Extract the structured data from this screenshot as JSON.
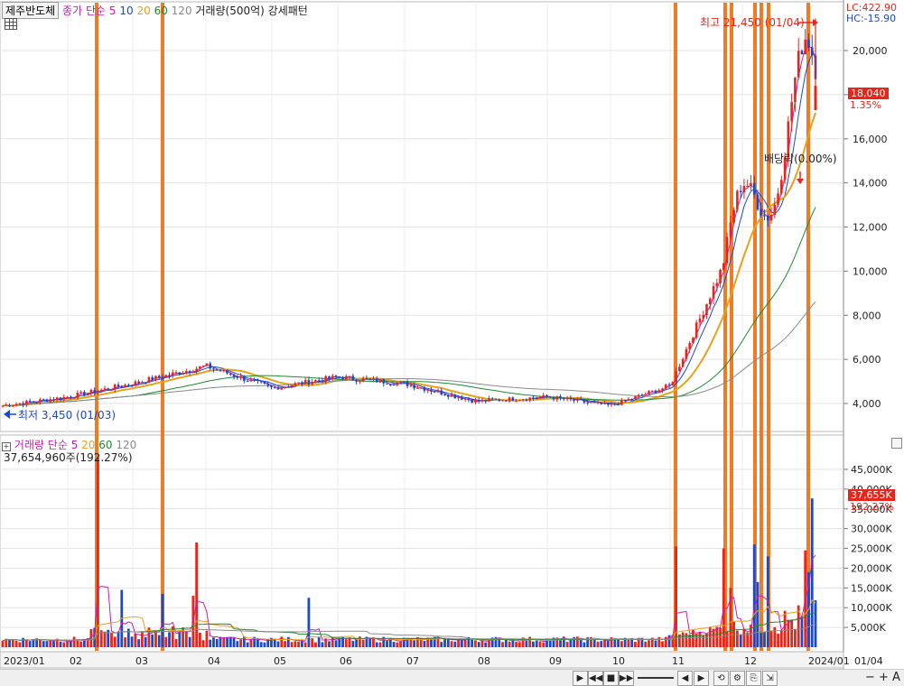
{
  "header": {
    "stock_name": "제주반도체",
    "price_label": "종가",
    "ma_label": "단순",
    "ma_periods": [
      "5",
      "10",
      "20",
      "60",
      "120"
    ],
    "volume_text": "거래량(500억)",
    "pattern_text": "강세패턴"
  },
  "price_panel": {
    "lc": "LC:422.90",
    "hc": "HC:-15.90",
    "high_annotation": "최고 21,450 (01/04)",
    "low_annotation": "최저 3,450 (01/03)",
    "dividend_annotation": "배당락(0.00%)",
    "current_price": "18,040",
    "current_change": "1.35%",
    "y_ticks": [
      "20,000",
      "18,000",
      "16,000",
      "14,000",
      "12,000",
      "10,000",
      "8,000",
      "6,000",
      "4,000"
    ]
  },
  "volume_panel": {
    "title": "거래량",
    "ma_label": "단순",
    "ma_periods": [
      "5",
      "20",
      "60",
      "120"
    ],
    "volume_detail": "37,654,960주(192.27%)",
    "current_volume": "37,655K",
    "current_ratio": "192.27%",
    "y_ticks": [
      "45,000K",
      "40,000K",
      "35,000K",
      "30,000K",
      "25,000K",
      "20,000K",
      "15,000K",
      "10,000K",
      "5,000K"
    ]
  },
  "x_axis": {
    "labels": [
      "2023/01",
      "02",
      "03",
      "04",
      "05",
      "06",
      "07",
      "08",
      "09",
      "10",
      "11",
      "12",
      "2024/01",
      "01/04"
    ]
  },
  "colors": {
    "up": "#e8251a",
    "down": "#1b49c8",
    "ma5": "#c21fb0",
    "ma10": "#1b49c8",
    "ma20": "#e8a11a",
    "ma60": "#1e8a2e",
    "ma120": "#8a8a8a",
    "signal": "#f07418"
  },
  "chart_data": [
    {
      "type": "candlestick",
      "title": "제주반도체",
      "x": [
        "2023-01",
        "2023-02",
        "2023-03",
        "2023-04",
        "2023-05",
        "2023-06",
        "2023-07",
        "2023-08",
        "2023-09",
        "2023-10",
        "2023-11",
        "2023-12",
        "2024-01"
      ],
      "series": [
        {
          "name": "종가",
          "values": [
            3900,
            4300,
            4900,
            5700,
            4700,
            5200,
            4900,
            4100,
            4300,
            3900,
            4800,
            12200,
            18040
          ]
        }
      ],
      "annotations": [
        {
          "text": "최고 21,450 (01/04)",
          "value": 21450,
          "date": "01/04"
        },
        {
          "text": "최저 3,450 (01/03)",
          "value": 3450,
          "date": "01/03"
        },
        {
          "text": "배당락(0.00%)"
        }
      ],
      "ylim": [
        3200,
        21900
      ],
      "current_value": 18040
    },
    {
      "type": "bar",
      "title": "거래량",
      "x": [
        "2023-01",
        "2023-02",
        "2023-03",
        "2023-04",
        "2023-05",
        "2023-06",
        "2023-07",
        "2023-08",
        "2023-09",
        "2023-10",
        "2023-11",
        "2023-12",
        "2024-01"
      ],
      "series": [
        {
          "name": "거래량",
          "values": [
            1200,
            48000,
            13500,
            26500,
            2500,
            12500,
            1500,
            1500,
            2800,
            1000,
            25500,
            25000,
            37655
          ]
        }
      ],
      "ylim": [
        0,
        50000
      ],
      "current_value": 37655
    }
  ]
}
